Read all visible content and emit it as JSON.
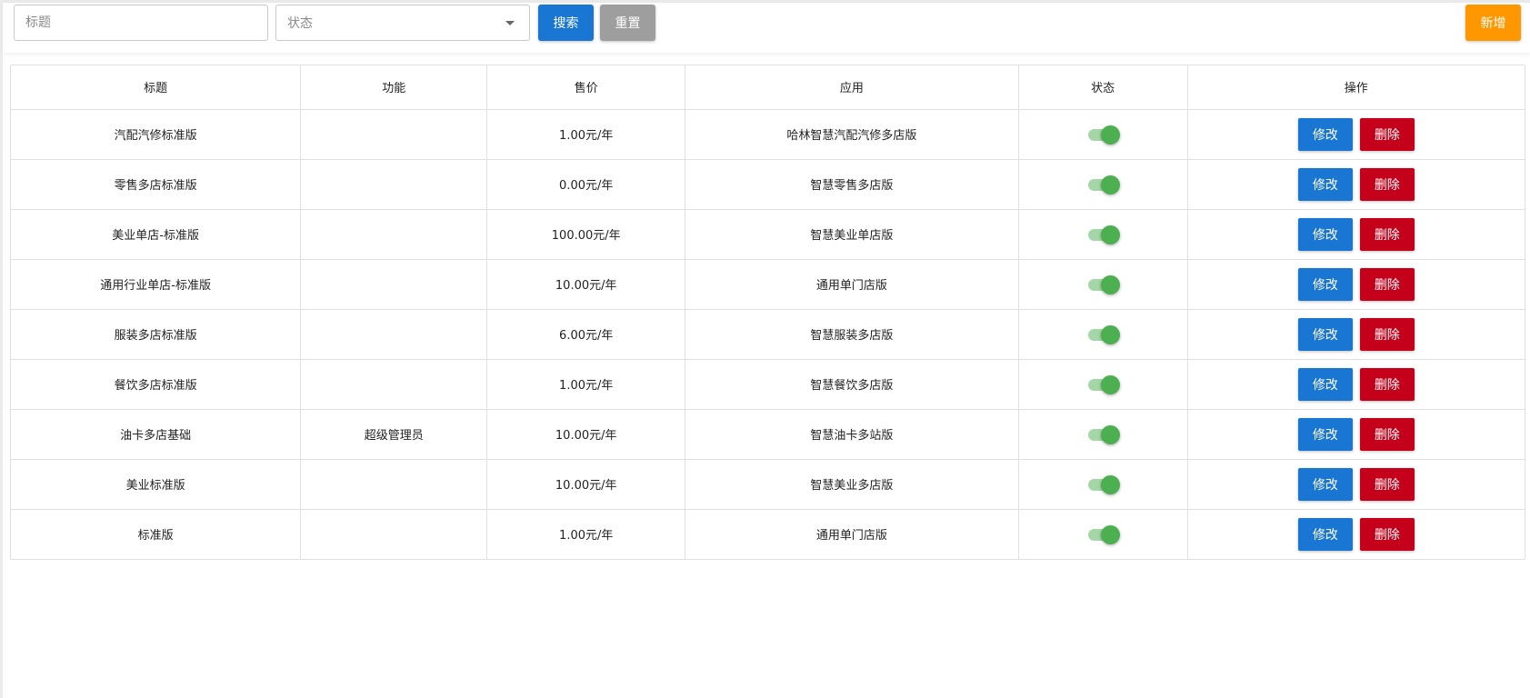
{
  "toolbar": {
    "title_placeholder": "标题",
    "status_placeholder": "状态",
    "search_label": "搜索",
    "reset_label": "重置",
    "add_label": "新增"
  },
  "table": {
    "headers": [
      "标题",
      "功能",
      "售价",
      "应用",
      "状态",
      "操作"
    ],
    "edit_label": "修改",
    "delete_label": "删除",
    "rows": [
      {
        "title": "汽配汽修标准版",
        "feature": "",
        "price": "1.00元/年",
        "app": "哈林智慧汽配汽修多店版",
        "status_on": true
      },
      {
        "title": "零售多店标准版",
        "feature": "",
        "price": "0.00元/年",
        "app": "智慧零售多店版",
        "status_on": true
      },
      {
        "title": "美业单店-标准版",
        "feature": "",
        "price": "100.00元/年",
        "app": "智慧美业单店版",
        "status_on": true
      },
      {
        "title": "通用行业单店-标准版",
        "feature": "",
        "price": "10.00元/年",
        "app": "通用单门店版",
        "status_on": true
      },
      {
        "title": "服装多店标准版",
        "feature": "",
        "price": "6.00元/年",
        "app": "智慧服装多店版",
        "status_on": true
      },
      {
        "title": "餐饮多店标准版",
        "feature": "",
        "price": "1.00元/年",
        "app": "智慧餐饮多店版",
        "status_on": true
      },
      {
        "title": "油卡多店基础",
        "feature": "超级管理员",
        "price": "10.00元/年",
        "app": "智慧油卡多站版",
        "status_on": true
      },
      {
        "title": "美业标准版",
        "feature": "",
        "price": "10.00元/年",
        "app": "智慧美业多店版",
        "status_on": true
      },
      {
        "title": "标准版",
        "feature": "",
        "price": "1.00元/年",
        "app": "通用单门店版",
        "status_on": true
      }
    ]
  },
  "colors": {
    "primary": "#1976d2",
    "reset": "#9e9e9e",
    "add": "#ff9800",
    "delete": "#c4001a",
    "switch_on": "#4caf50"
  }
}
